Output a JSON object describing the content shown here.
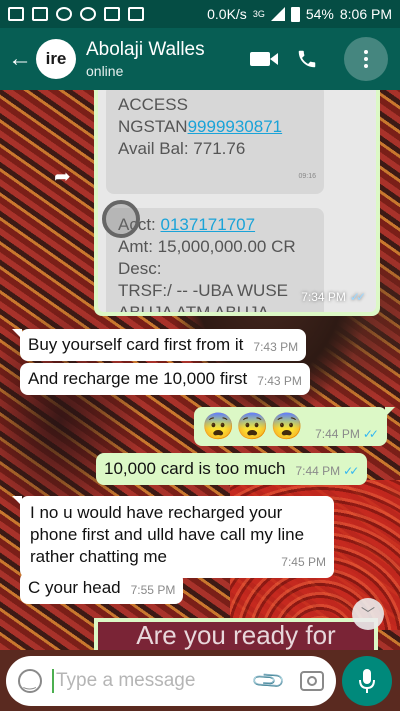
{
  "status_bar": {
    "speed": "0.0K/s",
    "network": "3G",
    "battery": "54%",
    "time": "8:06 PM"
  },
  "header": {
    "avatar_text": "ire",
    "contact_name": "Abolaji Walles",
    "contact_status": "online"
  },
  "image_message": {
    "sms1_lines": [
      "ACCESS",
      "NGSTAN",
      "9999930871",
      "Avail Bal: 771.76"
    ],
    "sms1_time": "09:16",
    "sms2_lines": [
      "Acct: ",
      "0137171707",
      "Amt: 15,000,000.00 CR",
      "Desc:",
      "TRSF:/ -- -UBA WUSE",
      "ABUJA ATM ABUJA"
    ],
    "time": "7:34 PM"
  },
  "messages": [
    {
      "text": "Buy yourself card first from it",
      "time": "7:43 PM"
    },
    {
      "text": "And recharge me 10,000 first",
      "time": "7:43 PM"
    },
    {
      "text": "😨😨😨",
      "time": "7:44 PM"
    },
    {
      "text": "10,000 card is too much",
      "time": "7:44 PM"
    },
    {
      "text": "I no u would have recharged your phone first and ulld have call my line rather chatting me",
      "time": "7:45 PM"
    },
    {
      "text": "C your head",
      "time": "7:55 PM"
    }
  ],
  "banner_text": "Are you ready for today's",
  "input": {
    "placeholder": "Type a message"
  },
  "colors": {
    "header": "#075e54",
    "statusbar": "#054d44",
    "outgoing": "#dcf8c6",
    "incoming": "#ffffff",
    "ticks": "#34b7f1",
    "mic": "#00897b"
  }
}
